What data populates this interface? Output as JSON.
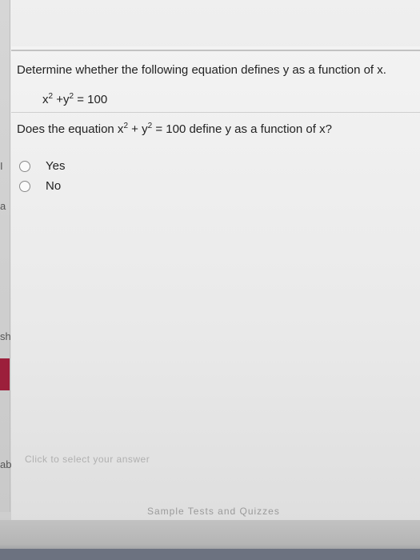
{
  "question": {
    "intro": "Determine whether the following equation defines y as a function of x.",
    "equation_parts": [
      "x",
      "2",
      " +y",
      "2",
      " = 100"
    ],
    "prompt_parts": [
      "Does the equation x",
      "2",
      " + y",
      "2",
      " = 100 define y as a function of x?"
    ]
  },
  "options": [
    {
      "label": "Yes",
      "selected": false
    },
    {
      "label": "No",
      "selected": false
    }
  ],
  "hint": "Click to select your answer",
  "footer": {
    "link": "Sample Tests and Quizzes"
  },
  "left_strip": {
    "fragments": [
      "I",
      "a",
      "sh",
      "ab"
    ]
  }
}
